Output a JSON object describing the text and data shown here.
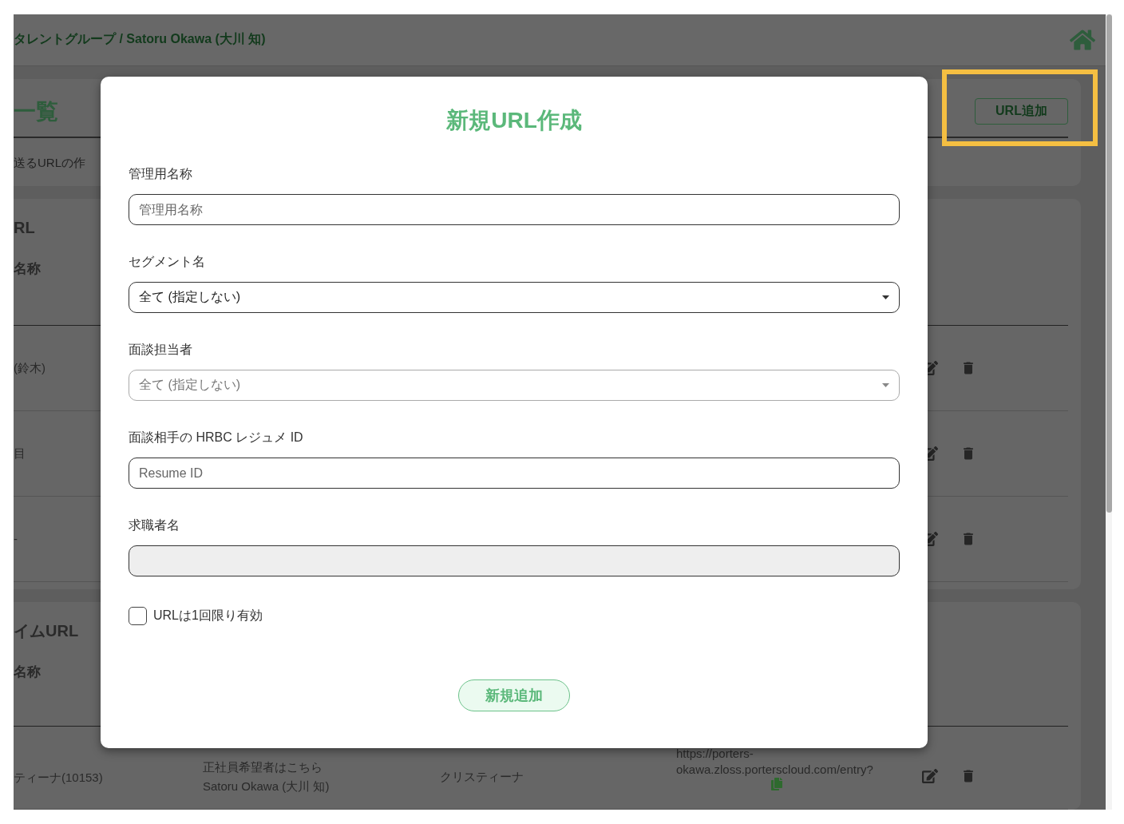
{
  "header": {
    "title": "タレントグループ / Satoru Okawa (大川 知)"
  },
  "summary_card": {
    "heading": "一覧",
    "description": "送るURLの作",
    "add_button": "URL追加"
  },
  "url_section": {
    "heading": "RL",
    "column_1": "名称",
    "rows": [
      {
        "column_1": "(鈴木)"
      },
      {
        "column_1": "目"
      },
      {
        "column_1": "-"
      }
    ]
  },
  "custom_section": {
    "heading": "イムURL",
    "column_1": "名称",
    "rows": [
      {
        "column_1": "ティーナ(10153)",
        "column_2": [
          "正社員希望者はこちら",
          "Satoru Okawa (大川 知)"
        ],
        "column_3": "クリスティーナ",
        "column_4": [
          "https://porters-",
          "okawa.zloss.porterscloud.com/entry?"
        ]
      }
    ]
  },
  "dialog": {
    "title": "新規URL作成",
    "fields": [
      {
        "label": "管理用名称",
        "kind": "text",
        "placeholder": "管理用名称",
        "disabled": false
      },
      {
        "label": "セグメント名",
        "kind": "select",
        "value": "全て (指定しない)",
        "disabled": false
      },
      {
        "label": "面談担当者",
        "kind": "select",
        "value": "全て (指定しない)",
        "disabled": true
      },
      {
        "label": "面談相手の HRBC レジュメ ID",
        "kind": "text",
        "placeholder": "Resume ID",
        "disabled": false
      },
      {
        "label": "求職者名",
        "kind": "text",
        "disabled": true
      }
    ],
    "checkbox": {
      "label": "URLは1回限り有効",
      "checked": false
    },
    "submit_button": "新規追加"
  }
}
